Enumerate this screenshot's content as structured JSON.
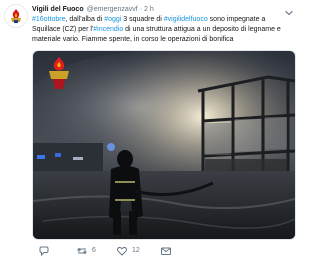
{
  "tweet": {
    "display_name": "Vigili del Fuoco",
    "handle": "@emergenzavvf",
    "separator": "·",
    "time": "2 h",
    "text_segments": [
      {
        "type": "link",
        "text": "#16ottobre"
      },
      {
        "type": "text",
        "text": ", dall'alba di "
      },
      {
        "type": "link",
        "text": "#oggi"
      },
      {
        "type": "text",
        "text": " 3 squadre di "
      },
      {
        "type": "link",
        "text": "#vigilidelfuoco"
      },
      {
        "type": "text",
        "text": " sono impegnate a Squillace (CZ) per l'"
      },
      {
        "type": "link",
        "text": "#incendio"
      },
      {
        "type": "text",
        "text": " di una struttura attigua a un deposito di legname e materiale vario. Fiamme spente, in corso le operazioni di bonifica"
      }
    ],
    "media": {
      "description_icon": "fire-scene-photo"
    },
    "actions": {
      "reply_count": "",
      "retweet_count": "6",
      "like_count": "12"
    },
    "colors": {
      "link": "#1b95e0",
      "secondary": "#657786",
      "brand_red": "#c8102e"
    }
  }
}
